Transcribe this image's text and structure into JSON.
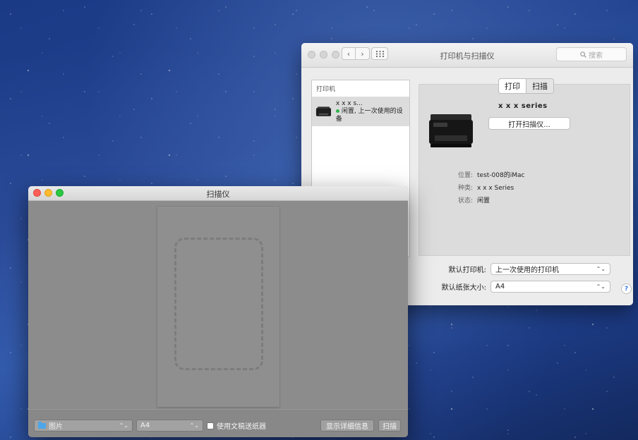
{
  "prefs_window": {
    "title": "打印机与扫描仪",
    "search_placeholder": "搜索",
    "printer_list_header": "打印机",
    "printer_item": {
      "name": "x x x  s...",
      "status": "闲置, 上一次使用的设备"
    },
    "tabs": [
      {
        "label": "打印",
        "active": false
      },
      {
        "label": "扫描",
        "active": true
      }
    ],
    "detail_name": "x x x   series",
    "open_scanner_label": "打开扫描仪...",
    "info": [
      {
        "label": "位置:",
        "value": "test-008的iMac"
      },
      {
        "label": "种类:",
        "value": "x x x  Series"
      },
      {
        "label": "状态:",
        "value": "闲置"
      }
    ],
    "default_printer_label": "默认打印机:",
    "default_printer_value": "上一次使用的打印机",
    "default_paper_label": "默认纸张大小:",
    "default_paper_value": "A4",
    "help_label": "?"
  },
  "scanner_window": {
    "title": "扫描仪",
    "destination_value": "图片",
    "size_value": "A4",
    "feeder_label": "使用文稿送纸器",
    "show_details_label": "显示详细信息",
    "scan_label": "扫描"
  },
  "colors": {
    "traffic_red": "#fc5f57",
    "traffic_yellow": "#fdbc2e",
    "traffic_green": "#28c840",
    "status_green": "#2fb54a"
  }
}
